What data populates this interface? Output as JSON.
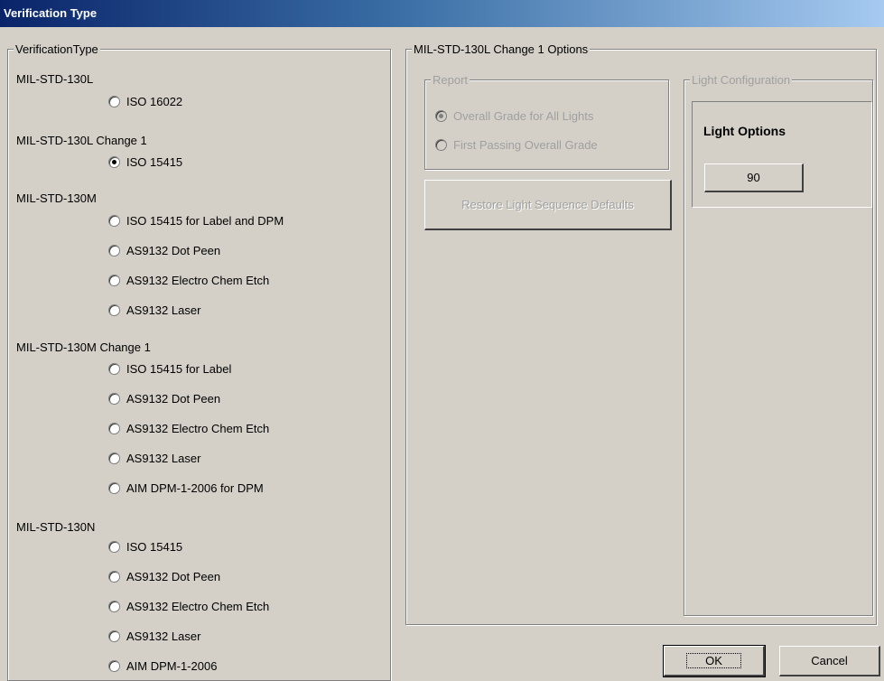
{
  "window": {
    "title": "Verification Type"
  },
  "left_group": {
    "legend": "VerificationType",
    "sections": [
      {
        "label": "MIL-STD-130L",
        "options": [
          {
            "label": "ISO 16022",
            "checked": false
          }
        ]
      },
      {
        "label": "MIL-STD-130L Change 1",
        "options": [
          {
            "label": "ISO 15415",
            "checked": true
          }
        ]
      },
      {
        "label": "MIL-STD-130M",
        "options": [
          {
            "label": "ISO 15415 for Label and DPM",
            "checked": false
          },
          {
            "label": "AS9132 Dot Peen",
            "checked": false
          },
          {
            "label": "AS9132 Electro Chem Etch",
            "checked": false
          },
          {
            "label": "AS9132 Laser",
            "checked": false
          }
        ]
      },
      {
        "label": "MIL-STD-130M Change 1",
        "options": [
          {
            "label": "ISO 15415 for Label",
            "checked": false
          },
          {
            "label": "AS9132 Dot Peen",
            "checked": false
          },
          {
            "label": "AS9132 Electro Chem Etch",
            "checked": false
          },
          {
            "label": "AS9132 Laser",
            "checked": false
          },
          {
            "label": "AIM DPM-1-2006 for DPM",
            "checked": false
          }
        ]
      },
      {
        "label": "MIL-STD-130N",
        "options": [
          {
            "label": "ISO 15415",
            "checked": false
          },
          {
            "label": "AS9132 Dot Peen",
            "checked": false
          },
          {
            "label": "AS9132 Electro Chem Etch",
            "checked": false
          },
          {
            "label": "AS9132 Laser",
            "checked": false
          },
          {
            "label": "AIM DPM-1-2006",
            "checked": false
          }
        ]
      }
    ]
  },
  "right_group": {
    "legend": "MIL-STD-130L Change 1 Options",
    "report": {
      "legend": "Report",
      "options": [
        {
          "label": "Overall Grade for All Lights",
          "checked": true
        },
        {
          "label": "First Passing Overall Grade",
          "checked": false
        }
      ]
    },
    "restore_button": "Restore Light Sequence Defaults",
    "light_config": {
      "legend": "Light Configuration",
      "heading": "Light Options",
      "value_button": "90"
    }
  },
  "buttons": {
    "ok": "OK",
    "cancel": "Cancel"
  }
}
